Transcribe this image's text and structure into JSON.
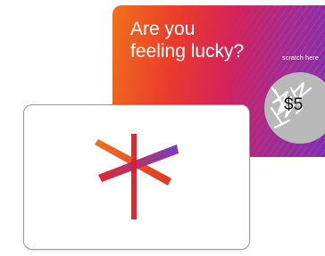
{
  "scratch_card": {
    "headline_line1": "Are you",
    "headline_line2": "feeling lucky?",
    "scratch_hint": "scratch here",
    "prize": "$5"
  },
  "icons": {
    "scratch_marks": "scribble-icon",
    "logo": "crossed-flag-logo-icon"
  },
  "colors": {
    "gradient_orange": "#f0711c",
    "gradient_red": "#ea3a2c",
    "gradient_magenta": "#d4245a",
    "gradient_purple": "#7a2fb8",
    "scratch_silver": "#b9b9b9",
    "logo_orange": "#f0711c",
    "logo_red": "#e0262f",
    "logo_purple": "#7a3fc0"
  }
}
